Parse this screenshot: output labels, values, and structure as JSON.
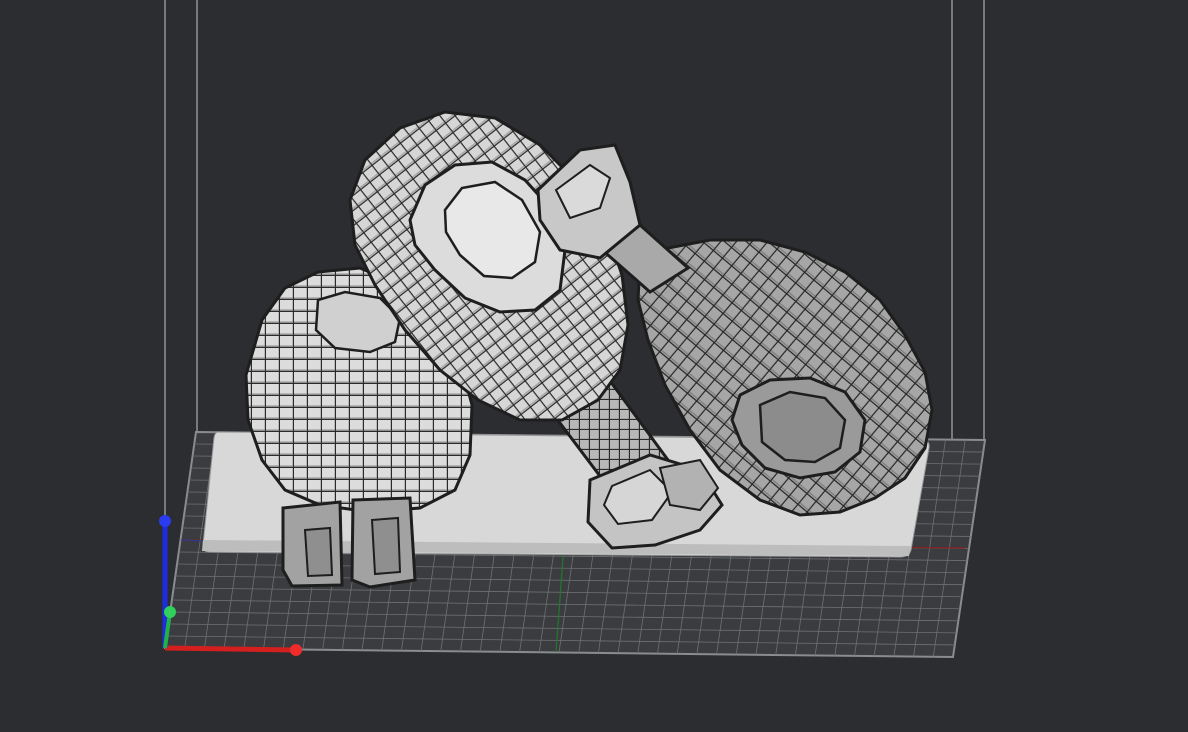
{
  "viewport": {
    "background": "#2b2d30",
    "grid_color": "#6e7073",
    "volume_outline_color": "#77797c",
    "build_plate_color": "#d9d9d9"
  },
  "axes": {
    "x_color": "#e11d1d",
    "y_color": "#22c55e",
    "z_color": "#1d2de1"
  },
  "model": {
    "fill_light": "#e3e3e3",
    "fill_mid": "#bdbdbd",
    "fill_dark": "#8e8e8e",
    "outline": "#1a1a1a"
  }
}
